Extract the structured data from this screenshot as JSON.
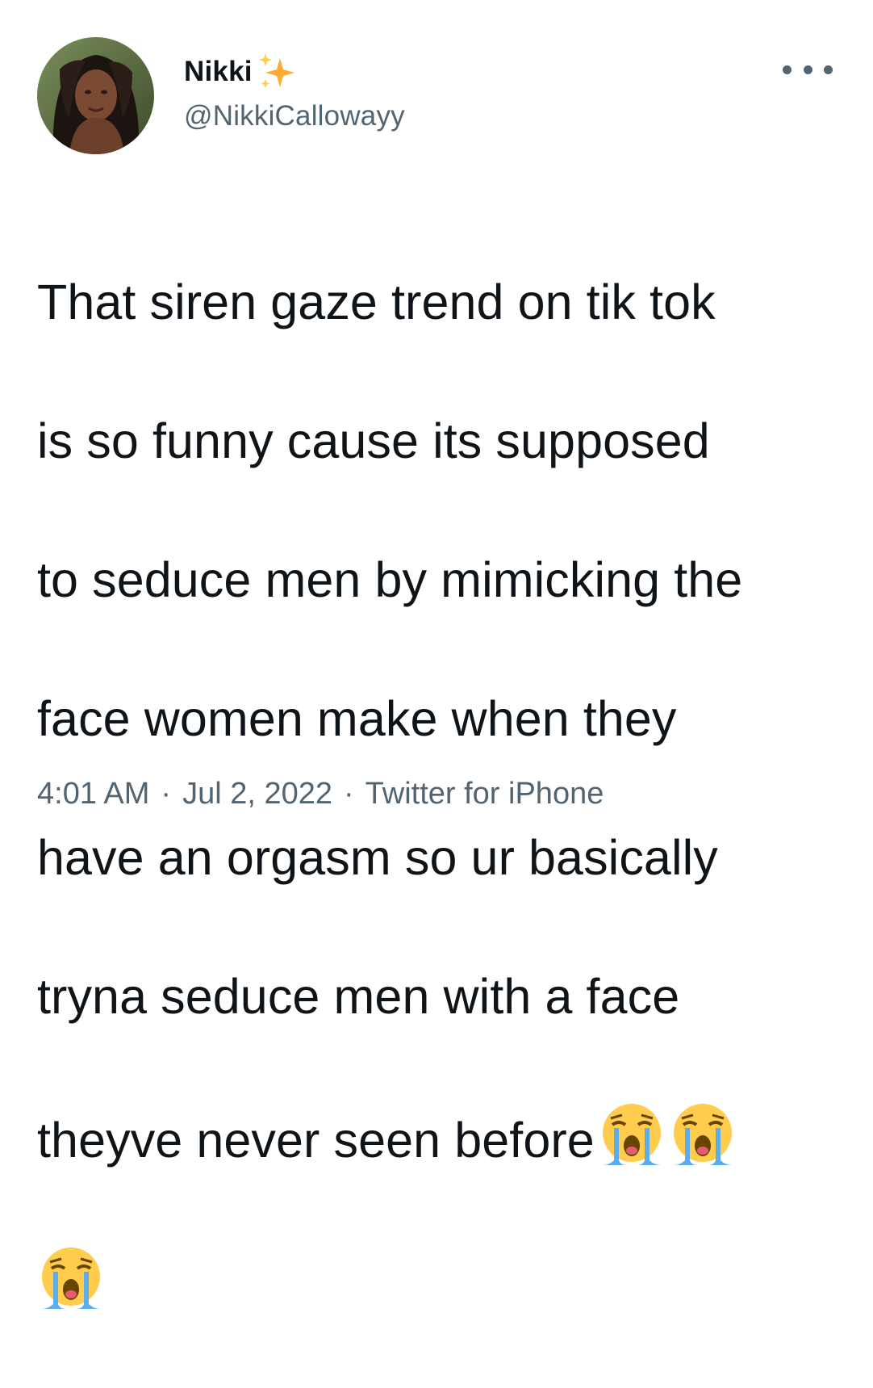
{
  "author": {
    "display_name": "Nikki",
    "handle": "@NikkiCallowayy",
    "badge_icon": "sparkles-icon",
    "avatar": "profile-photo"
  },
  "more_icon": "more-horizontal-icon",
  "tweet": {
    "lines": [
      "That siren gaze trend on tik tok",
      "is so funny cause its supposed",
      "to seduce men by mimicking the",
      "face women make when they",
      "have an orgasm so ur basically",
      "tryna seduce men with a face",
      "theyve never seen before"
    ],
    "emoji": [
      "loudly-crying-face",
      "loudly-crying-face",
      "loudly-crying-face"
    ]
  },
  "meta": {
    "time": "4:01 AM",
    "separator": "·",
    "date": "Jul 2, 2022",
    "source": "Twitter for iPhone"
  },
  "colors": {
    "text_primary": "#0f1419",
    "text_secondary": "#536471",
    "emoji_yellow": "#ffcc4d",
    "tears_blue": "#5dadec"
  }
}
